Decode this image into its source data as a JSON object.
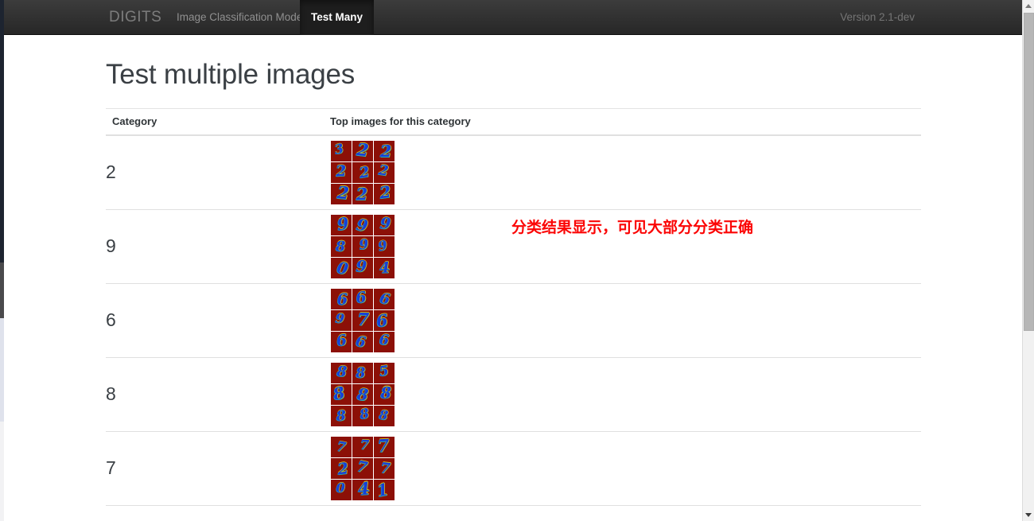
{
  "navbar": {
    "brand": "DIGITS",
    "links": [
      {
        "label": "Image Classification Model",
        "active": false
      },
      {
        "label": "Test Many",
        "active": true
      }
    ],
    "version": "Version 2.1-dev",
    "background_color": "#2b2b2b",
    "active_tab_color": "#1e1e1e"
  },
  "page": {
    "title": "Test multiple images"
  },
  "table": {
    "headers": {
      "category": "Category",
      "images": "Top images for this category"
    },
    "rows": [
      {
        "category": "2",
        "image_grid": [
          [
            "3",
            "2",
            "2"
          ],
          [
            "2",
            "2",
            "2"
          ],
          [
            "2",
            "2",
            "2"
          ]
        ]
      },
      {
        "category": "9",
        "image_grid": [
          [
            "9",
            "9",
            "9"
          ],
          [
            "8",
            "9",
            "9"
          ],
          [
            "0",
            "9",
            "4"
          ]
        ]
      },
      {
        "category": "6",
        "image_grid": [
          [
            "6",
            "6",
            "6"
          ],
          [
            "9",
            "7",
            "6"
          ],
          [
            "6",
            "6",
            "6"
          ]
        ]
      },
      {
        "category": "8",
        "image_grid": [
          [
            "8",
            "8",
            "5"
          ],
          [
            "8",
            "8",
            "8"
          ],
          [
            "8",
            "8",
            "8"
          ]
        ]
      },
      {
        "category": "7",
        "image_grid": [
          [
            "7",
            "7",
            "7"
          ],
          [
            "2",
            "7",
            "7"
          ],
          [
            "0",
            "4",
            "1"
          ]
        ]
      }
    ],
    "tile_background_color": "#8c1007",
    "tile_digit_color": "#1540d8"
  },
  "annotation": {
    "text": "分类结果显示，可见大部分分类正确",
    "color": "#fb0505"
  },
  "scrollbar": {
    "up_arrow": "scroll-up-arrow",
    "down_arrow": "scroll-down-arrow"
  }
}
